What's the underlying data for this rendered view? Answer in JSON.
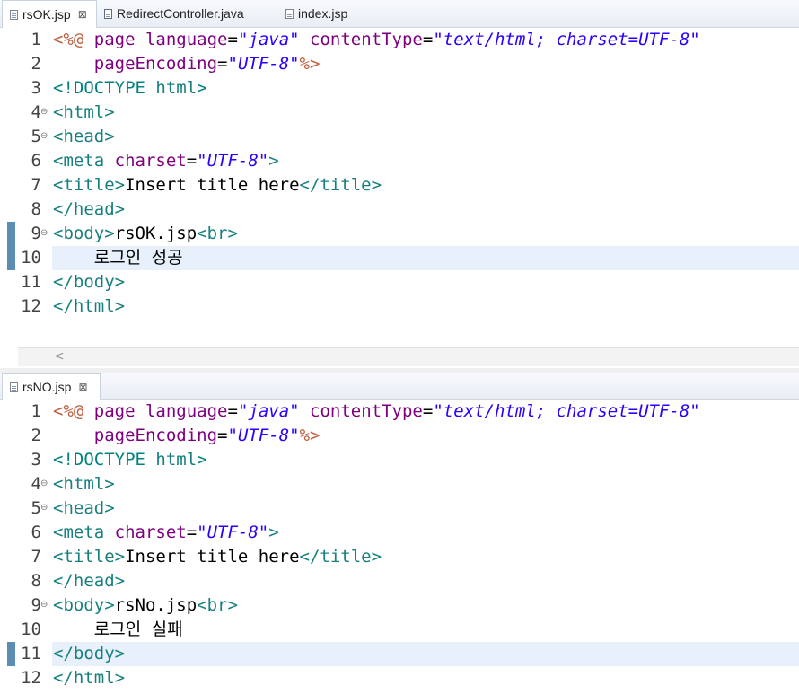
{
  "editor_top": {
    "tabs": [
      {
        "label": "rsOK.jsp",
        "active": true,
        "close": "⊠"
      },
      {
        "label": "RedirectController.java",
        "active": false
      },
      {
        "label": "index.jsp",
        "active": false
      }
    ],
    "lines": [
      {
        "n": "1",
        "tokens": [
          [
            "jsp",
            "<%@ "
          ],
          [
            "attr",
            "page "
          ],
          [
            "attr",
            "language"
          ],
          [
            "txt",
            "="
          ],
          [
            "val",
            "\"java\""
          ],
          [
            "txt",
            " "
          ],
          [
            "attr",
            "contentType"
          ],
          [
            "txt",
            "="
          ],
          [
            "val",
            "\"text/html; charset=UTF-8\""
          ]
        ]
      },
      {
        "n": "2",
        "tokens": [
          [
            "txt",
            "    "
          ],
          [
            "attr",
            "pageEncoding"
          ],
          [
            "txt",
            "="
          ],
          [
            "val",
            "\"UTF-8\""
          ],
          [
            "jsp",
            "%>"
          ]
        ]
      },
      {
        "n": "3",
        "tokens": [
          [
            "doc",
            "<!DOCTYPE "
          ],
          [
            "tag",
            "html"
          ],
          [
            "doc",
            ">"
          ]
        ]
      },
      {
        "n": "4",
        "fold": true,
        "tokens": [
          [
            "tag",
            "<html>"
          ]
        ]
      },
      {
        "n": "5",
        "fold": true,
        "tokens": [
          [
            "tag",
            "<head>"
          ]
        ]
      },
      {
        "n": "6",
        "tokens": [
          [
            "tag",
            "<meta "
          ],
          [
            "attr",
            "charset"
          ],
          [
            "txt",
            "="
          ],
          [
            "val",
            "\"UTF-8\""
          ],
          [
            "tag",
            ">"
          ]
        ]
      },
      {
        "n": "7",
        "tokens": [
          [
            "tag",
            "<title>"
          ],
          [
            "txt",
            "Insert title here"
          ],
          [
            "tag",
            "</title>"
          ]
        ]
      },
      {
        "n": "8",
        "tokens": [
          [
            "tag",
            "</head>"
          ]
        ]
      },
      {
        "n": "9",
        "fold": true,
        "mark": true,
        "tokens": [
          [
            "tag",
            "<body>"
          ],
          [
            "txt",
            "rsOK.jsp"
          ],
          [
            "tag",
            "<br>"
          ]
        ]
      },
      {
        "n": "10",
        "mark": true,
        "current": true,
        "tokens": [
          [
            "txt",
            "    로그인 성공"
          ]
        ]
      },
      {
        "n": "11",
        "tokens": [
          [
            "tag",
            "</body>"
          ]
        ]
      },
      {
        "n": "12",
        "tokens": [
          [
            "tag",
            "</html>"
          ]
        ]
      }
    ],
    "scroll_left": "<"
  },
  "editor_bottom": {
    "tabs": [
      {
        "label": "rsNO.jsp",
        "active": true,
        "close": "⊠"
      }
    ],
    "lines": [
      {
        "n": "1",
        "tokens": [
          [
            "jsp",
            "<%@ "
          ],
          [
            "attr",
            "page "
          ],
          [
            "attr",
            "language"
          ],
          [
            "txt",
            "="
          ],
          [
            "val",
            "\"java\""
          ],
          [
            "txt",
            " "
          ],
          [
            "attr",
            "contentType"
          ],
          [
            "txt",
            "="
          ],
          [
            "val",
            "\"text/html; charset=UTF-8\""
          ]
        ]
      },
      {
        "n": "2",
        "tokens": [
          [
            "txt",
            "    "
          ],
          [
            "attr",
            "pageEncoding"
          ],
          [
            "txt",
            "="
          ],
          [
            "val",
            "\"UTF-8\""
          ],
          [
            "jsp",
            "%>"
          ]
        ]
      },
      {
        "n": "3",
        "tokens": [
          [
            "doc",
            "<!DOCTYPE "
          ],
          [
            "tag",
            "html"
          ],
          [
            "doc",
            ">"
          ]
        ]
      },
      {
        "n": "4",
        "fold": true,
        "tokens": [
          [
            "tag",
            "<html>"
          ]
        ]
      },
      {
        "n": "5",
        "fold": true,
        "tokens": [
          [
            "tag",
            "<head>"
          ]
        ]
      },
      {
        "n": "6",
        "tokens": [
          [
            "tag",
            "<meta "
          ],
          [
            "attr",
            "charset"
          ],
          [
            "txt",
            "="
          ],
          [
            "val",
            "\"UTF-8\""
          ],
          [
            "tag",
            ">"
          ]
        ]
      },
      {
        "n": "7",
        "tokens": [
          [
            "tag",
            "<title>"
          ],
          [
            "txt",
            "Insert title here"
          ],
          [
            "tag",
            "</title>"
          ]
        ]
      },
      {
        "n": "8",
        "tokens": [
          [
            "tag",
            "</head>"
          ]
        ]
      },
      {
        "n": "9",
        "fold": true,
        "tokens": [
          [
            "tag",
            "<body>"
          ],
          [
            "txt",
            "rsNo.jsp"
          ],
          [
            "tag",
            "<br>"
          ]
        ]
      },
      {
        "n": "10",
        "tokens": [
          [
            "txt",
            "    로그인 실패"
          ]
        ]
      },
      {
        "n": "11",
        "mark": true,
        "current": true,
        "tokens": [
          [
            "tag",
            "</body>"
          ]
        ]
      },
      {
        "n": "12",
        "tokens": [
          [
            "tag",
            "</html>"
          ]
        ]
      }
    ]
  }
}
